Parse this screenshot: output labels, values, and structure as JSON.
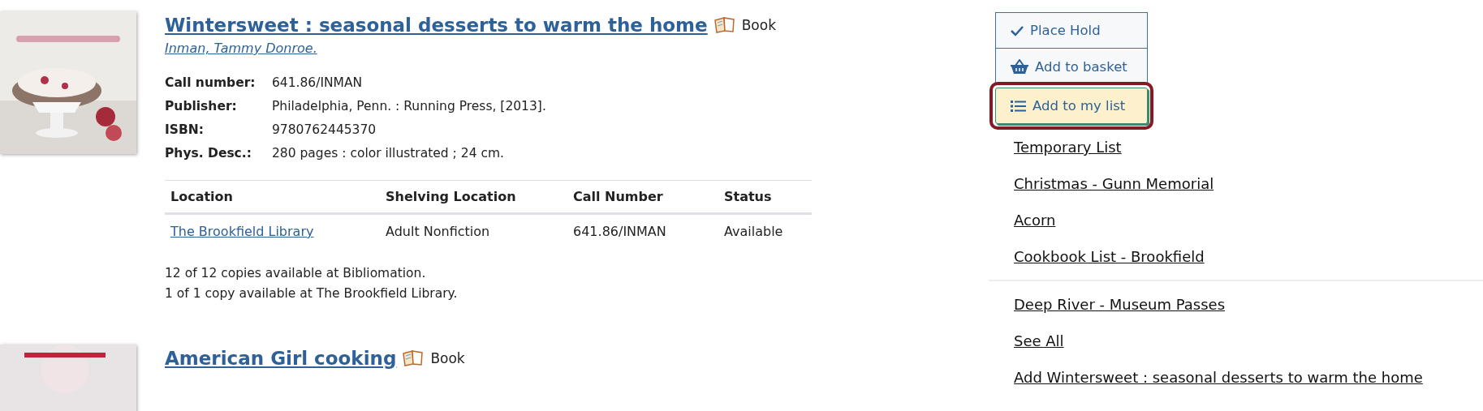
{
  "records": [
    {
      "title": "Wintersweet : seasonal desserts to warm the home",
      "format": "Book",
      "author": "Inman, Tammy Donroe.",
      "details": [
        {
          "label": "Call number:",
          "value": "641.86/INMAN"
        },
        {
          "label": "Publisher:",
          "value": "Philadelphia, Penn. : Running Press, [2013]."
        },
        {
          "label": "ISBN:",
          "value": "9780762445370"
        },
        {
          "label": "Phys. Desc.:",
          "value": "280 pages : color illustrated ; 24 cm."
        }
      ],
      "holdings": {
        "columns": [
          "Location",
          "Shelving Location",
          "Call Number",
          "Status"
        ],
        "rows": [
          [
            "The Brookfield Library",
            "Adult Nonfiction",
            "641.86/INMAN",
            "Available"
          ]
        ]
      },
      "availability": [
        "12 of 12 copies available at Bibliomation.",
        "1 of 1 copy available at The Brookfield Library."
      ]
    },
    {
      "title": "American Girl cooking",
      "format": "Book"
    }
  ],
  "actions": [
    {
      "kind": "hold",
      "label": "Place Hold",
      "focused": false
    },
    {
      "kind": "basket",
      "label": "Add to basket",
      "focused": false
    },
    {
      "kind": "list",
      "label": "Add to my list",
      "focused": true
    }
  ],
  "list_menu": {
    "groups": [
      [
        "Temporary List",
        "Christmas - Gunn Memorial",
        "Acorn",
        "Cookbook List - Brookfield"
      ],
      [
        "Deep River - Museum Passes",
        "See All",
        "Add Wintersweet : seasonal desserts to warm the home"
      ]
    ]
  }
}
